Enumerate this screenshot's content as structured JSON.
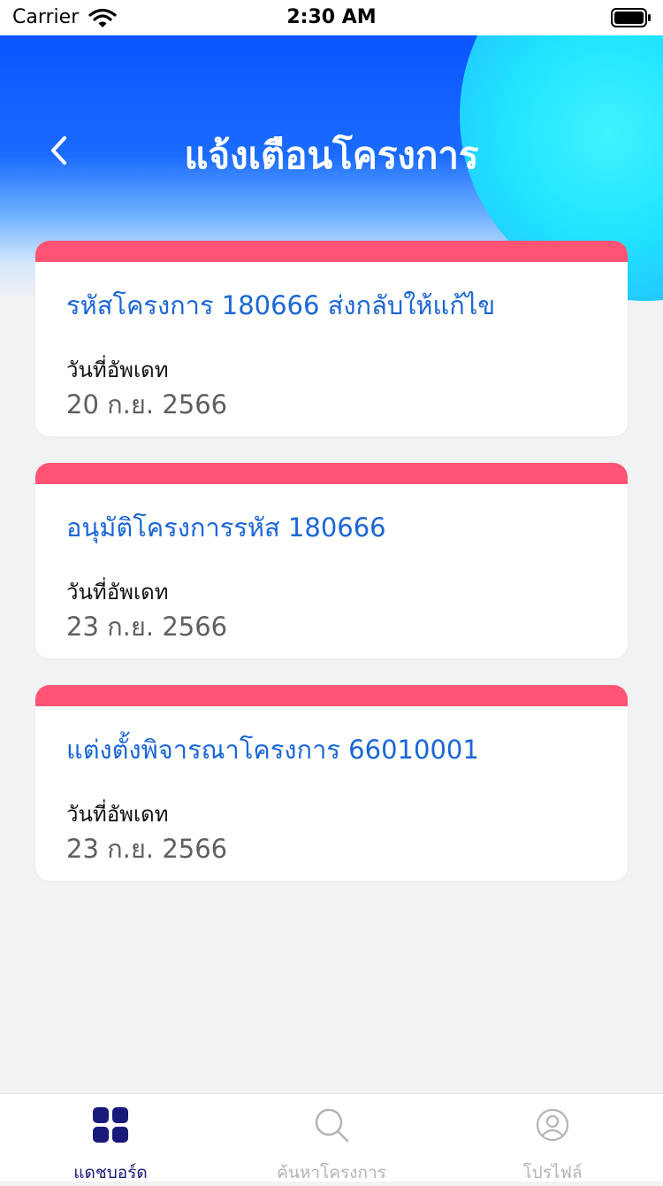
{
  "status_bar": {
    "carrier": "Carrier",
    "time": "2:30 AM"
  },
  "header": {
    "title": "แจ้งเตือนโครงการ",
    "back_icon": "chevron-left-icon"
  },
  "notifications": [
    {
      "title": "รหัสโครงการ 180666 ส่งกลับให้แก้ไข",
      "date_label": "วันที่อัพเดท",
      "date": "20 ก.ย. 2566"
    },
    {
      "title": "อนุมัติโครงการรหัส 180666",
      "date_label": "วันที่อัพเดท",
      "date": "23 ก.ย. 2566"
    },
    {
      "title": "แต่งตั้งพิจารณาโครงการ 66010001",
      "date_label": "วันที่อัพเดท",
      "date": "23 ก.ย. 2566"
    }
  ],
  "tabbar": {
    "tabs": [
      {
        "label": "แดชบอร์ด",
        "icon": "dashboard-grid-icon",
        "active": true
      },
      {
        "label": "ค้นหาโครงการ",
        "icon": "search-icon",
        "active": false
      },
      {
        "label": "โปรไฟล์",
        "icon": "profile-icon",
        "active": false
      }
    ]
  },
  "colors": {
    "accent_stripe": "#ff5473",
    "title_blue": "#1a66d6",
    "active_tab": "#1a1a7a"
  }
}
